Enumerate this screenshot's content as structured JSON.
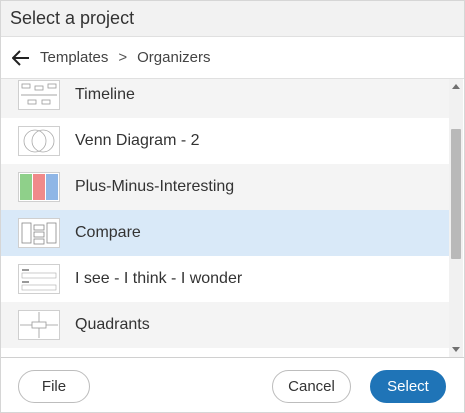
{
  "dialog": {
    "title": "Select a project"
  },
  "breadcrumb": {
    "items": [
      "Templates",
      "Organizers"
    ],
    "separator": ">"
  },
  "templates": [
    {
      "label": "Timeline",
      "icon": "timeline-thumbnail"
    },
    {
      "label": "Venn Diagram - 2",
      "icon": "venn-diagram-thumbnail"
    },
    {
      "label": "Plus-Minus-Interesting",
      "icon": "plus-minus-interesting-thumbnail"
    },
    {
      "label": "Compare",
      "icon": "compare-thumbnail",
      "selected": true
    },
    {
      "label": "I see - I think - I wonder",
      "icon": "see-think-wonder-thumbnail"
    },
    {
      "label": "Quadrants",
      "icon": "quadrants-thumbnail"
    }
  ],
  "buttons": {
    "file": "File",
    "cancel": "Cancel",
    "select": "Select"
  },
  "colors": {
    "primary": "#1f74b7",
    "selected_row": "#d9e9f8",
    "alt_row": "#f4f4f4"
  }
}
